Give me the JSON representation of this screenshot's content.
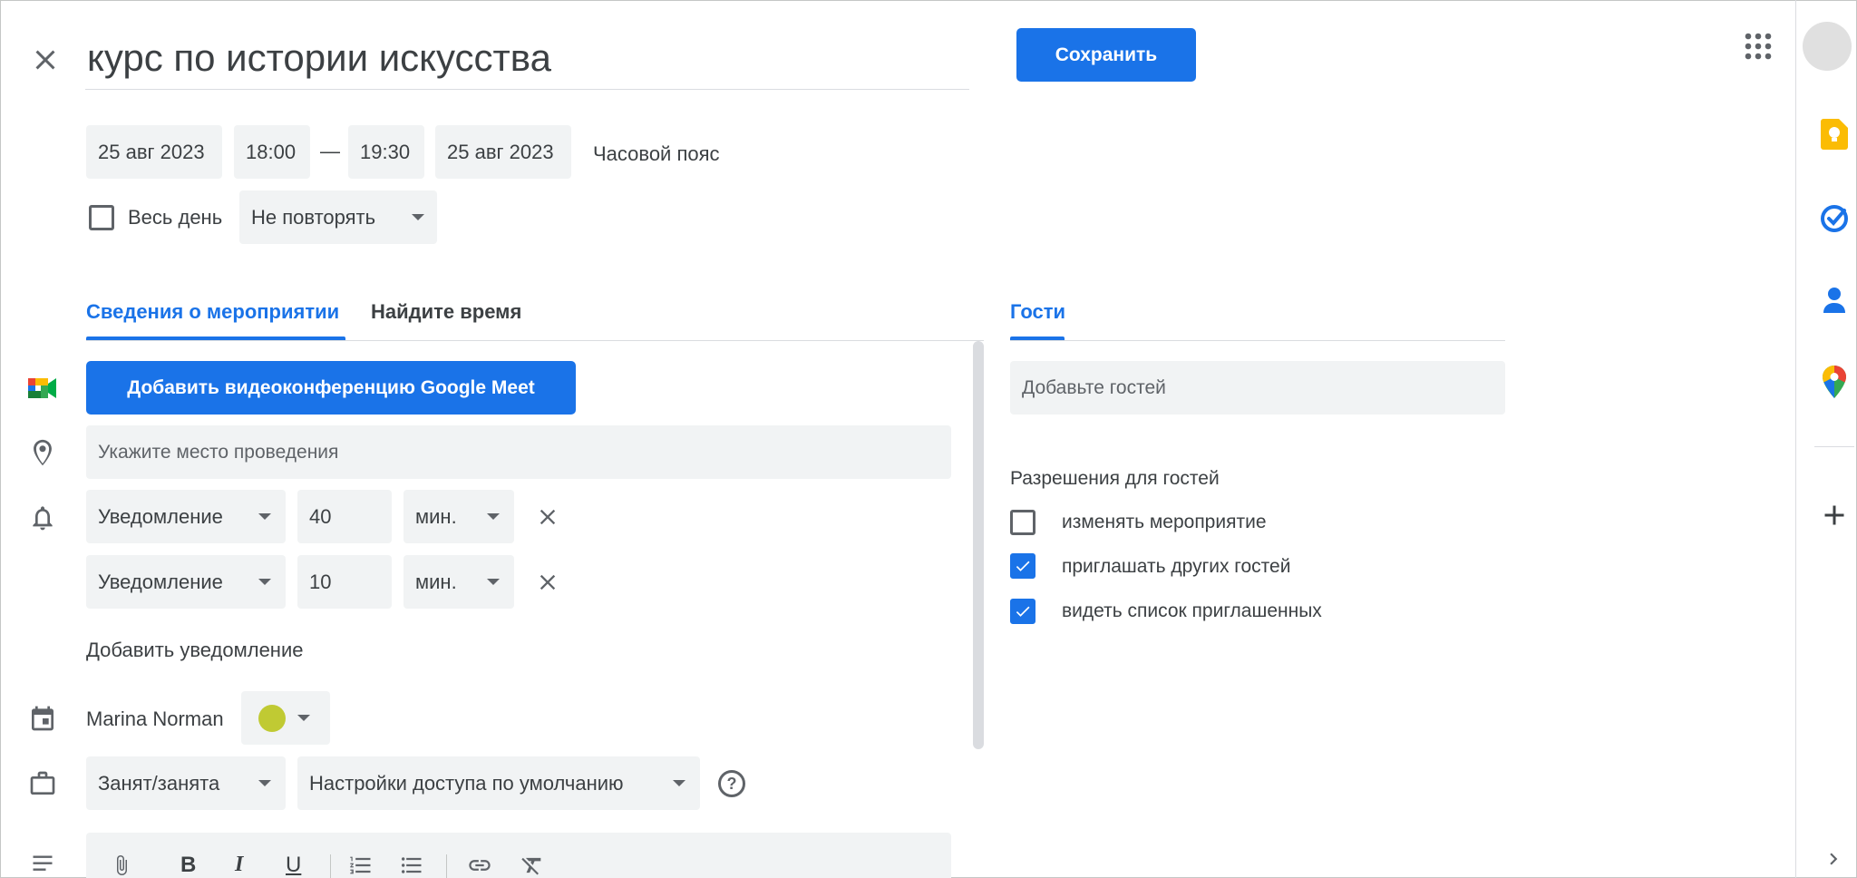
{
  "header": {
    "title": "курс по истории искусства",
    "save_label": "Сохранить"
  },
  "datetime": {
    "start_date": "25 авг 2023",
    "start_time": "18:00",
    "separator": "—",
    "end_time": "19:30",
    "end_date": "25 авг 2023",
    "timezone_label": "Часовой пояс",
    "all_day_label": "Весь день",
    "repeat_value": "Не повторять"
  },
  "tabs": {
    "details": "Сведения о мероприятии",
    "find_time": "Найдите время",
    "guests": "Гости"
  },
  "details": {
    "meet_button": "Добавить видеоконференцию Google Meet",
    "location_placeholder": "Укажите место проведения",
    "notifications": [
      {
        "type": "Уведомление",
        "amount": "40",
        "unit": "мин."
      },
      {
        "type": "Уведомление",
        "amount": "10",
        "unit": "мин."
      }
    ],
    "add_notification": "Добавить уведомление",
    "calendar_owner": "Marina Norman",
    "calendar_color": "#c0ca33",
    "busy_status": "Занят/занята",
    "visibility": "Настройки доступа по умолчанию"
  },
  "guests": {
    "add_placeholder": "Добавьте гостей",
    "permissions_title": "Разрешения для гостей",
    "permissions": [
      {
        "label": "изменять мероприятие",
        "checked": false
      },
      {
        "label": "приглашать других гостей",
        "checked": true
      },
      {
        "label": "видеть список приглашенных",
        "checked": true
      }
    ]
  },
  "colors": {
    "accent": "#1a73e8",
    "keep": "#fbbc04",
    "maps_green": "#34a853",
    "maps_red": "#ea4335"
  }
}
